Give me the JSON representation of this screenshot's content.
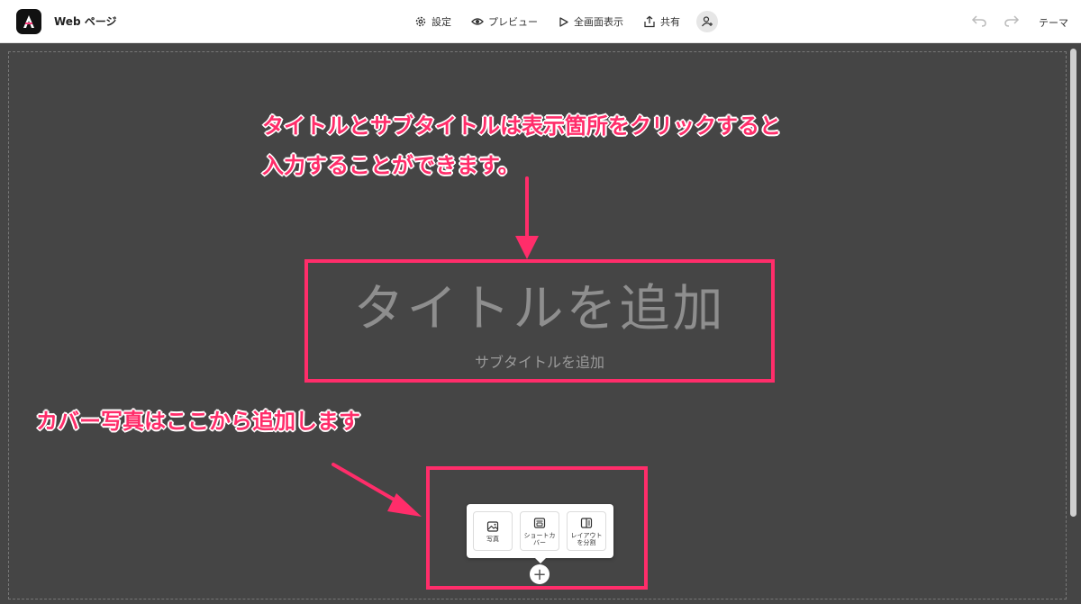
{
  "app": {
    "title": "Web ページ"
  },
  "toolbar": {
    "settings_label": "設定",
    "preview_label": "プレビュー",
    "fullscreen_label": "全画面表示",
    "share_label": "共有",
    "theme_label": "テーマ"
  },
  "annotations": {
    "title_note_line1": "タイトルとサブタイトルは表示箇所をクリックすると",
    "title_note_line2": "入力することができます。",
    "cover_note": "カバー写真はここから追加します"
  },
  "page": {
    "title_placeholder": "タイトルを追加",
    "subtitle_placeholder": "サブタイトルを追加"
  },
  "cover_popup": {
    "photo_label": "写真",
    "shortcut_label": "ショートカ\nバー",
    "split_layout_label": "レイアウト\nを分割",
    "add_symbol": "+"
  },
  "colors": {
    "annotation": "#ff2d6a",
    "canvas_bg": "#454545"
  }
}
